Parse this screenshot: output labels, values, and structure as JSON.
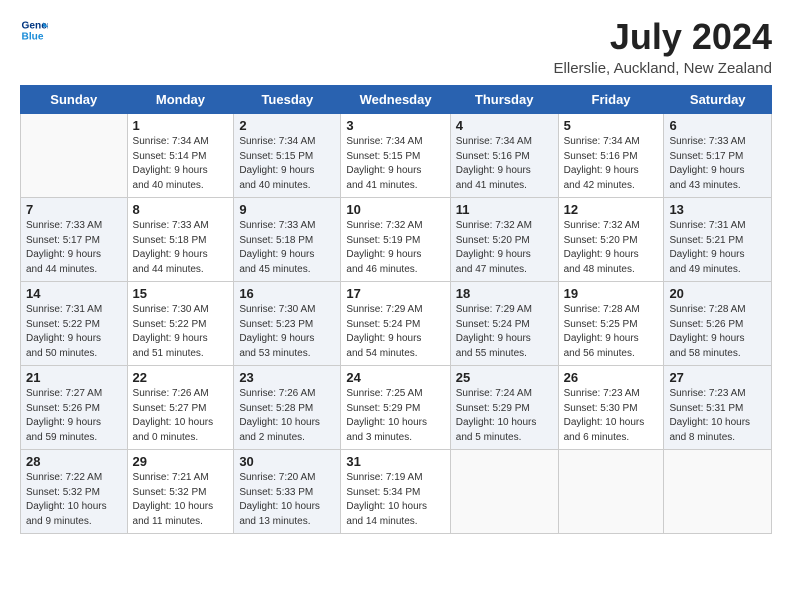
{
  "logo": {
    "line1": "General",
    "line2": "Blue"
  },
  "title": "July 2024",
  "subtitle": "Ellerslie, Auckland, New Zealand",
  "weekdays": [
    "Sunday",
    "Monday",
    "Tuesday",
    "Wednesday",
    "Thursday",
    "Friday",
    "Saturday"
  ],
  "weeks": [
    [
      {
        "day": "",
        "info": ""
      },
      {
        "day": "1",
        "info": "Sunrise: 7:34 AM\nSunset: 5:14 PM\nDaylight: 9 hours\nand 40 minutes."
      },
      {
        "day": "2",
        "info": "Sunrise: 7:34 AM\nSunset: 5:15 PM\nDaylight: 9 hours\nand 40 minutes."
      },
      {
        "day": "3",
        "info": "Sunrise: 7:34 AM\nSunset: 5:15 PM\nDaylight: 9 hours\nand 41 minutes."
      },
      {
        "day": "4",
        "info": "Sunrise: 7:34 AM\nSunset: 5:16 PM\nDaylight: 9 hours\nand 41 minutes."
      },
      {
        "day": "5",
        "info": "Sunrise: 7:34 AM\nSunset: 5:16 PM\nDaylight: 9 hours\nand 42 minutes."
      },
      {
        "day": "6",
        "info": "Sunrise: 7:33 AM\nSunset: 5:17 PM\nDaylight: 9 hours\nand 43 minutes."
      }
    ],
    [
      {
        "day": "7",
        "info": "Sunrise: 7:33 AM\nSunset: 5:17 PM\nDaylight: 9 hours\nand 44 minutes."
      },
      {
        "day": "8",
        "info": "Sunrise: 7:33 AM\nSunset: 5:18 PM\nDaylight: 9 hours\nand 44 minutes."
      },
      {
        "day": "9",
        "info": "Sunrise: 7:33 AM\nSunset: 5:18 PM\nDaylight: 9 hours\nand 45 minutes."
      },
      {
        "day": "10",
        "info": "Sunrise: 7:32 AM\nSunset: 5:19 PM\nDaylight: 9 hours\nand 46 minutes."
      },
      {
        "day": "11",
        "info": "Sunrise: 7:32 AM\nSunset: 5:20 PM\nDaylight: 9 hours\nand 47 minutes."
      },
      {
        "day": "12",
        "info": "Sunrise: 7:32 AM\nSunset: 5:20 PM\nDaylight: 9 hours\nand 48 minutes."
      },
      {
        "day": "13",
        "info": "Sunrise: 7:31 AM\nSunset: 5:21 PM\nDaylight: 9 hours\nand 49 minutes."
      }
    ],
    [
      {
        "day": "14",
        "info": "Sunrise: 7:31 AM\nSunset: 5:22 PM\nDaylight: 9 hours\nand 50 minutes."
      },
      {
        "day": "15",
        "info": "Sunrise: 7:30 AM\nSunset: 5:22 PM\nDaylight: 9 hours\nand 51 minutes."
      },
      {
        "day": "16",
        "info": "Sunrise: 7:30 AM\nSunset: 5:23 PM\nDaylight: 9 hours\nand 53 minutes."
      },
      {
        "day": "17",
        "info": "Sunrise: 7:29 AM\nSunset: 5:24 PM\nDaylight: 9 hours\nand 54 minutes."
      },
      {
        "day": "18",
        "info": "Sunrise: 7:29 AM\nSunset: 5:24 PM\nDaylight: 9 hours\nand 55 minutes."
      },
      {
        "day": "19",
        "info": "Sunrise: 7:28 AM\nSunset: 5:25 PM\nDaylight: 9 hours\nand 56 minutes."
      },
      {
        "day": "20",
        "info": "Sunrise: 7:28 AM\nSunset: 5:26 PM\nDaylight: 9 hours\nand 58 minutes."
      }
    ],
    [
      {
        "day": "21",
        "info": "Sunrise: 7:27 AM\nSunset: 5:26 PM\nDaylight: 9 hours\nand 59 minutes."
      },
      {
        "day": "22",
        "info": "Sunrise: 7:26 AM\nSunset: 5:27 PM\nDaylight: 10 hours\nand 0 minutes."
      },
      {
        "day": "23",
        "info": "Sunrise: 7:26 AM\nSunset: 5:28 PM\nDaylight: 10 hours\nand 2 minutes."
      },
      {
        "day": "24",
        "info": "Sunrise: 7:25 AM\nSunset: 5:29 PM\nDaylight: 10 hours\nand 3 minutes."
      },
      {
        "day": "25",
        "info": "Sunrise: 7:24 AM\nSunset: 5:29 PM\nDaylight: 10 hours\nand 5 minutes."
      },
      {
        "day": "26",
        "info": "Sunrise: 7:23 AM\nSunset: 5:30 PM\nDaylight: 10 hours\nand 6 minutes."
      },
      {
        "day": "27",
        "info": "Sunrise: 7:23 AM\nSunset: 5:31 PM\nDaylight: 10 hours\nand 8 minutes."
      }
    ],
    [
      {
        "day": "28",
        "info": "Sunrise: 7:22 AM\nSunset: 5:32 PM\nDaylight: 10 hours\nand 9 minutes."
      },
      {
        "day": "29",
        "info": "Sunrise: 7:21 AM\nSunset: 5:32 PM\nDaylight: 10 hours\nand 11 minutes."
      },
      {
        "day": "30",
        "info": "Sunrise: 7:20 AM\nSunset: 5:33 PM\nDaylight: 10 hours\nand 13 minutes."
      },
      {
        "day": "31",
        "info": "Sunrise: 7:19 AM\nSunset: 5:34 PM\nDaylight: 10 hours\nand 14 minutes."
      },
      {
        "day": "",
        "info": ""
      },
      {
        "day": "",
        "info": ""
      },
      {
        "day": "",
        "info": ""
      }
    ]
  ]
}
